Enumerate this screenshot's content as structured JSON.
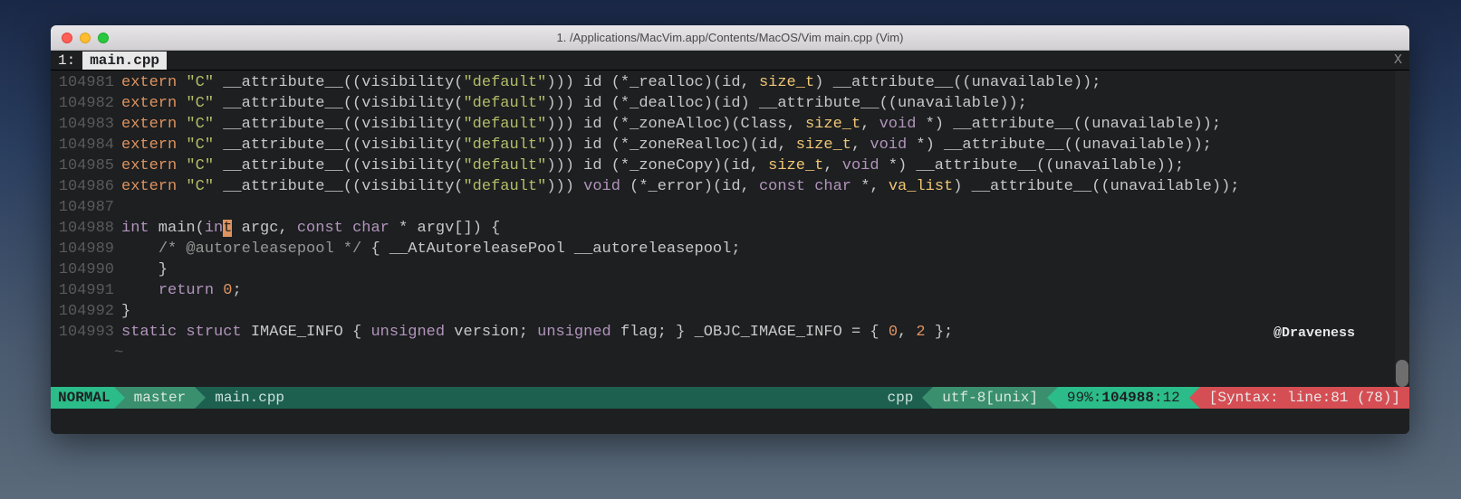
{
  "window": {
    "title": "1. /Applications/MacVim.app/Contents/MacOS/Vim main.cpp (Vim)"
  },
  "tab": {
    "prefix": "1:",
    "label": "main.cpp",
    "close": "X"
  },
  "watermark": "@Draveness",
  "lines": [
    {
      "num": "104981",
      "tokens": [
        [
          "ext",
          "extern"
        ],
        [
          "",
          " "
        ],
        [
          "str",
          "\"C\""
        ],
        [
          "",
          " __attribute__((visibility("
        ],
        [
          "str",
          "\"default\""
        ],
        [
          "",
          "))) id (*_realloc)(id, "
        ],
        [
          "type",
          "size_t"
        ],
        [
          "",
          ") __attribute__((unavailable));"
        ]
      ]
    },
    {
      "num": "104982",
      "tokens": [
        [
          "ext",
          "extern"
        ],
        [
          "",
          " "
        ],
        [
          "str",
          "\"C\""
        ],
        [
          "",
          " __attribute__((visibility("
        ],
        [
          "str",
          "\"default\""
        ],
        [
          "",
          "))) id (*_dealloc)(id) __attribute__((unavailable));"
        ]
      ]
    },
    {
      "num": "104983",
      "tokens": [
        [
          "ext",
          "extern"
        ],
        [
          "",
          " "
        ],
        [
          "str",
          "\"C\""
        ],
        [
          "",
          " __attribute__((visibility("
        ],
        [
          "str",
          "\"default\""
        ],
        [
          "",
          "))) id (*_zoneAlloc)(Class, "
        ],
        [
          "type",
          "size_t"
        ],
        [
          "",
          ", "
        ],
        [
          "kw",
          "void"
        ],
        [
          "",
          " *) __attribute__((unavailable));"
        ]
      ]
    },
    {
      "num": "104984",
      "tokens": [
        [
          "ext",
          "extern"
        ],
        [
          "",
          " "
        ],
        [
          "str",
          "\"C\""
        ],
        [
          "",
          " __attribute__((visibility("
        ],
        [
          "str",
          "\"default\""
        ],
        [
          "",
          "))) id (*_zoneRealloc)(id, "
        ],
        [
          "type",
          "size_t"
        ],
        [
          "",
          ", "
        ],
        [
          "kw",
          "void"
        ],
        [
          "",
          " *) __attribute__((unavailable));"
        ]
      ]
    },
    {
      "num": "104985",
      "tokens": [
        [
          "ext",
          "extern"
        ],
        [
          "",
          " "
        ],
        [
          "str",
          "\"C\""
        ],
        [
          "",
          " __attribute__((visibility("
        ],
        [
          "str",
          "\"default\""
        ],
        [
          "",
          "))) id (*_zoneCopy)(id, "
        ],
        [
          "type",
          "size_t"
        ],
        [
          "",
          ", "
        ],
        [
          "kw",
          "void"
        ],
        [
          "",
          " *) __attribute__((unavailable));"
        ]
      ]
    },
    {
      "num": "104986",
      "tokens": [
        [
          "ext",
          "extern"
        ],
        [
          "",
          " "
        ],
        [
          "str",
          "\"C\""
        ],
        [
          "",
          " __attribute__((visibility("
        ],
        [
          "str",
          "\"default\""
        ],
        [
          "",
          "))) "
        ],
        [
          "kw",
          "void"
        ],
        [
          "",
          " (*_error)(id, "
        ],
        [
          "kw",
          "const"
        ],
        [
          "",
          " "
        ],
        [
          "kw",
          "char"
        ],
        [
          "",
          " *, "
        ],
        [
          "type",
          "va_list"
        ],
        [
          "",
          ") __attribute__((unavailable));"
        ]
      ]
    },
    {
      "num": "104987",
      "tokens": []
    },
    {
      "num": "104988",
      "tokens": [
        [
          "kw",
          "int"
        ],
        [
          "",
          " main("
        ],
        [
          "kw",
          "in"
        ],
        [
          "cursor",
          "t"
        ],
        [
          "",
          " argc, "
        ],
        [
          "kw",
          "const"
        ],
        [
          "",
          " "
        ],
        [
          "kw",
          "char"
        ],
        [
          "",
          " * argv[]) {"
        ]
      ]
    },
    {
      "num": "104989",
      "tokens": [
        [
          "",
          "    "
        ],
        [
          "cmt",
          "/* @autoreleasepool */"
        ],
        [
          "",
          " { __AtAutoreleasePool __autoreleasepool;"
        ]
      ]
    },
    {
      "num": "104990",
      "tokens": [
        [
          "",
          "    }"
        ]
      ]
    },
    {
      "num": "104991",
      "tokens": [
        [
          "",
          "    "
        ],
        [
          "kw",
          "return"
        ],
        [
          "",
          " "
        ],
        [
          "num",
          "0"
        ],
        [
          "",
          ";"
        ]
      ]
    },
    {
      "num": "104992",
      "tokens": [
        [
          "",
          "}"
        ]
      ]
    },
    {
      "num": "104993",
      "tokens": [
        [
          "kw",
          "static"
        ],
        [
          "",
          " "
        ],
        [
          "kw",
          "struct"
        ],
        [
          "",
          " IMAGE_INFO { "
        ],
        [
          "kw",
          "unsigned"
        ],
        [
          "",
          " version; "
        ],
        [
          "kw",
          "unsigned"
        ],
        [
          "",
          " flag; } _OBJC_IMAGE_INFO = { "
        ],
        [
          "num",
          "0"
        ],
        [
          "",
          ", "
        ],
        [
          "num",
          "2"
        ],
        [
          "",
          " };"
        ]
      ]
    }
  ],
  "tilde": "~",
  "status": {
    "mode": "NORMAL",
    "branch": "master",
    "file": "main.cpp",
    "filetype": "cpp",
    "encoding": "utf-8[unix]",
    "percent": "99%",
    "line": "104988",
    "col": "12",
    "error": "[Syntax: line:81 (78)]"
  }
}
